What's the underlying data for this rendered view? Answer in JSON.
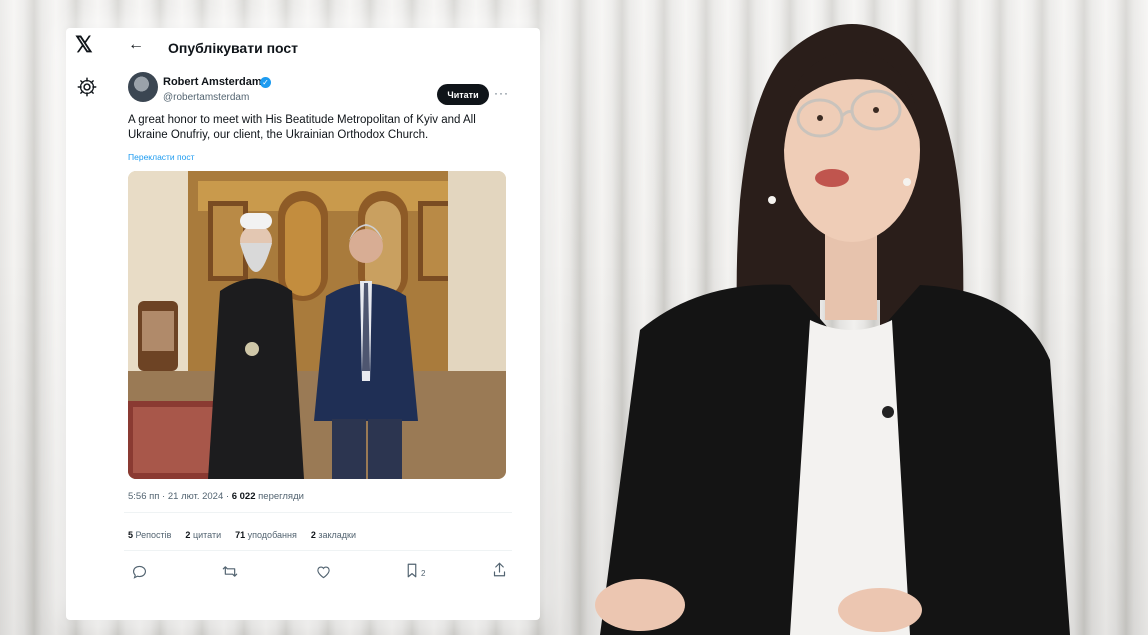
{
  "app": {
    "logo": "𝕏"
  },
  "header": {
    "back_icon": "←",
    "title": "Опублікувати пост"
  },
  "post": {
    "author_name": "Robert Amsterdam",
    "verified_mark": "✓",
    "author_handle": "@robertamsterdam",
    "follow_label": "Читати",
    "more_icon": "···",
    "text": "A great honor to meet with His Beatitude Metropolitan of Kyiv and All Ukraine Onufriy, our client, the Ukrainian Orthodox Church.",
    "translate_label": "Перекласти пост",
    "time": "5:56 пп",
    "separator": " · ",
    "date": "21 лют. 2024",
    "views_count": "6 022",
    "views_label": " перегляди"
  },
  "stats": {
    "reposts_count": "5",
    "reposts_label": " Репостів",
    "quotes_count": "2",
    "quotes_label": " цитати",
    "likes_count": "71",
    "likes_label": " уподобання",
    "bookmarks_count": "2",
    "bookmarks_label": " закладки"
  },
  "actions": {
    "reply_icon": "💬",
    "repost_icon": "⇄",
    "like_icon": "♡",
    "bookmark_icon": "🔖",
    "bookmark_count": "2",
    "share_icon": "⇪"
  },
  "colors": {
    "accent": "#1d9bf0",
    "text_primary": "#0f1419",
    "text_secondary": "#536471"
  }
}
